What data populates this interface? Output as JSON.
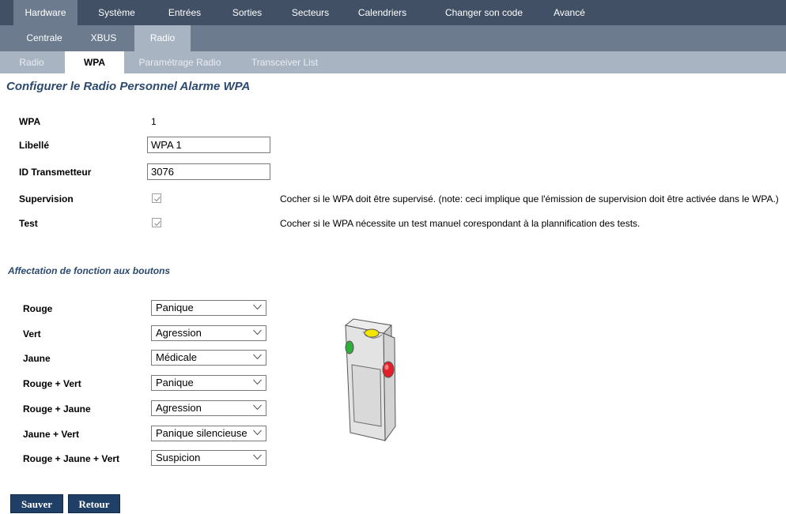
{
  "nav": {
    "top": [
      "Hardware",
      "Système",
      "Entrées",
      "Sorties",
      "Secteurs",
      "Calendriers",
      "Changer son code",
      "Avancé"
    ],
    "second": [
      "Centrale",
      "XBUS",
      "Radio"
    ],
    "third": [
      "Radio",
      "WPA",
      "Paramétrage Radio",
      "Transceiver List"
    ]
  },
  "page_title": "Configurer le Radio Personnel Alarme WPA",
  "form": {
    "wpa_label": "WPA",
    "wpa_value": "1",
    "libelle_label": "Libellé",
    "libelle_value": "WPA 1",
    "id_label": "ID Transmetteur",
    "id_value": "3076",
    "supervision_label": "Supervision",
    "supervision_checked": true,
    "supervision_note": "Cocher si le WPA doit être supervisé. (note: ceci implique que l'émission de supervision doit être activée dans le WPA.)",
    "test_label": "Test",
    "test_checked": true,
    "test_note": "Cocher si le WPA nécessite un test manuel corespondant à la plannification des tests."
  },
  "buttons_section": {
    "title": "Affectation de fonction aux boutons",
    "rows": [
      {
        "label": "Rouge",
        "value": "Panique"
      },
      {
        "label": "Vert",
        "value": "Agression"
      },
      {
        "label": "Jaune",
        "value": "Médicale"
      },
      {
        "label": "Rouge + Vert",
        "value": "Panique"
      },
      {
        "label": "Rouge + Jaune",
        "value": "Agression"
      },
      {
        "label": "Jaune + Vert",
        "value": "Panique silencieuse"
      },
      {
        "label": "Rouge + Jaune + Vert",
        "value": "Suspicion"
      }
    ]
  },
  "actions": {
    "save": "Sauver",
    "back": "Retour"
  },
  "colors": {
    "nav_dark": "#425066",
    "nav_mid": "#6d7b8f",
    "nav_light": "#a9b4c3",
    "title": "#2c4a6e",
    "button": "#1f3f66"
  }
}
